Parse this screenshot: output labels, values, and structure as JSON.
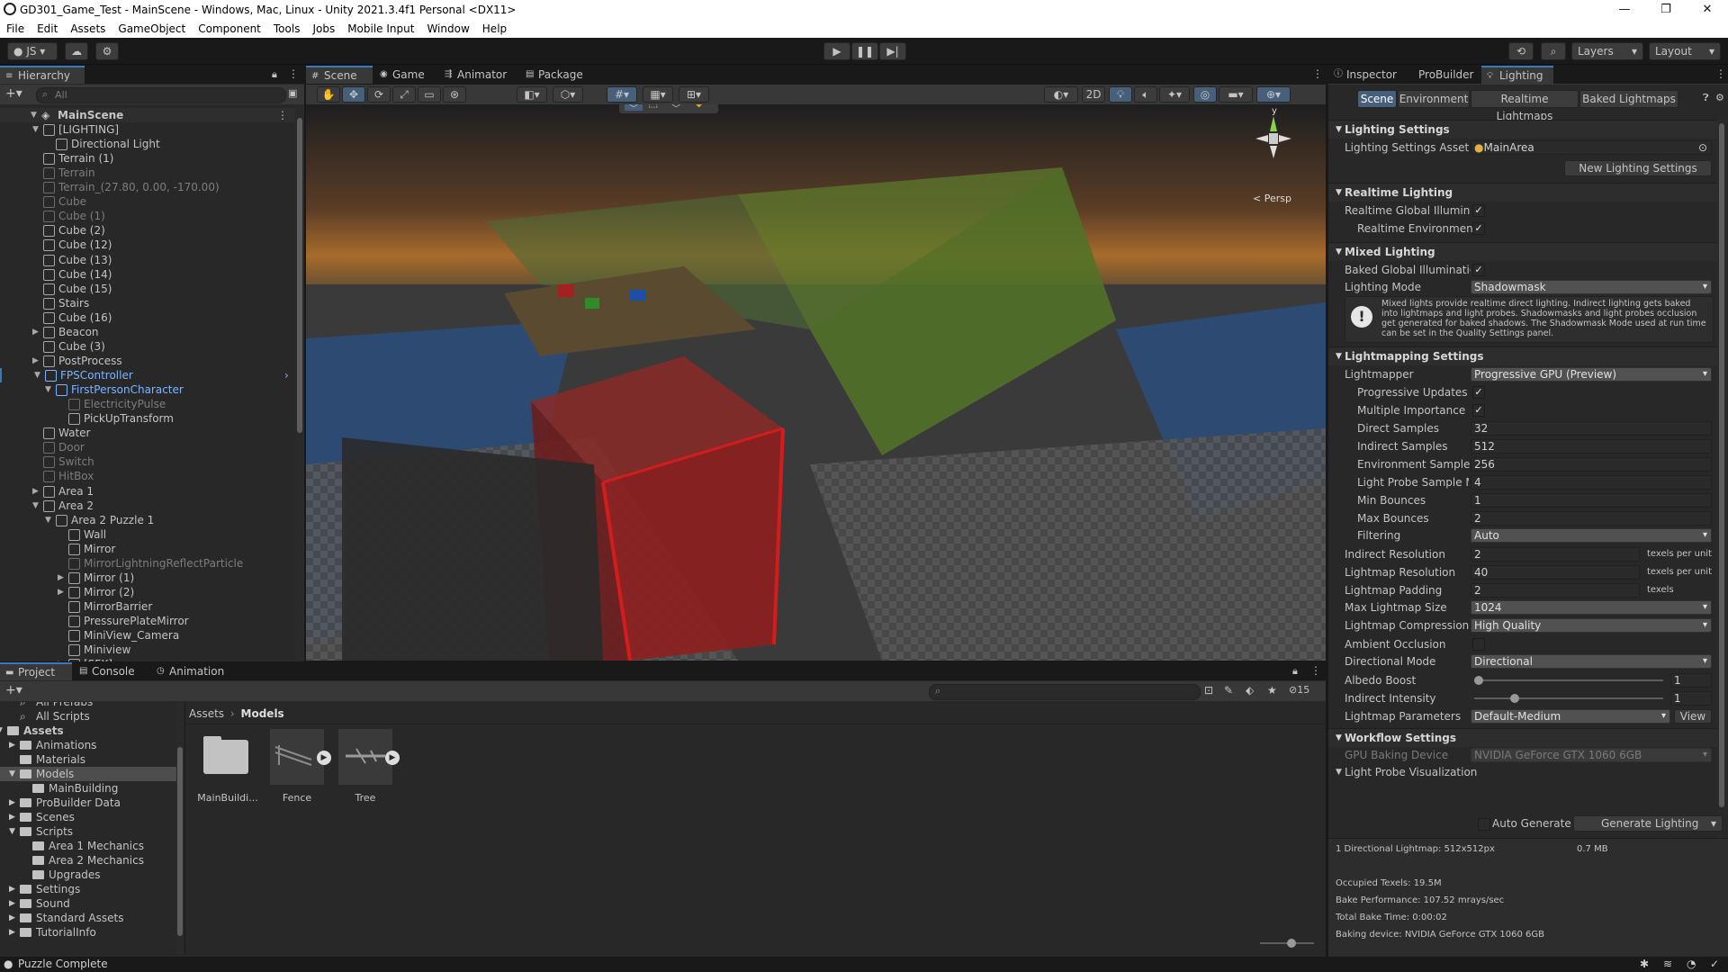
{
  "window": {
    "title": "GD301_Game_Test - MainScene - Windows, Mac, Linux - Unity 2021.3.4f1 Personal <DX11>",
    "minimize_icon": "minimize-icon",
    "restore_icon": "restore-icon",
    "close_icon": "close-icon"
  },
  "menu": [
    "File",
    "Edit",
    "Assets",
    "GameObject",
    "Component",
    "Tools",
    "Jobs",
    "Mobile Input",
    "Window",
    "Help"
  ],
  "toolbar": {
    "account": "JS",
    "layers": "Layers",
    "layout": "Layout"
  },
  "hierarchy": {
    "tab": "Hierarchy",
    "search_placeholder": "All",
    "scene": "MainScene",
    "items": [
      {
        "label": "[LIGHTING]",
        "state": "normal"
      },
      {
        "label": "Directional Light",
        "state": "normal"
      },
      {
        "label": "Terrain (1)",
        "state": "normal"
      },
      {
        "label": "Terrain",
        "state": "dim"
      },
      {
        "label": "Terrain_(27.80, 0.00, -170.00)",
        "state": "dim"
      },
      {
        "label": "Cube",
        "state": "dim"
      },
      {
        "label": "Cube (1)",
        "state": "dim"
      },
      {
        "label": "Cube (2)",
        "state": "normal"
      },
      {
        "label": "Cube (12)",
        "state": "normal"
      },
      {
        "label": "Cube (13)",
        "state": "normal"
      },
      {
        "label": "Cube (14)",
        "state": "normal"
      },
      {
        "label": "Cube (15)",
        "state": "normal"
      },
      {
        "label": "Stairs",
        "state": "normal"
      },
      {
        "label": "Cube (16)",
        "state": "normal"
      },
      {
        "label": "Beacon",
        "state": "normal"
      },
      {
        "label": "Cube (3)",
        "state": "normal"
      },
      {
        "label": "PostProcess",
        "state": "normal"
      },
      {
        "label": "FPSController",
        "state": "blue"
      },
      {
        "label": "FirstPersonCharacter",
        "state": "blue"
      },
      {
        "label": "ElectricityPulse",
        "state": "dim"
      },
      {
        "label": "PickUpTransform",
        "state": "normal"
      },
      {
        "label": "Water",
        "state": "normal"
      },
      {
        "label": "Door",
        "state": "dim"
      },
      {
        "label": "Switch",
        "state": "dim"
      },
      {
        "label": "HitBox",
        "state": "dim"
      },
      {
        "label": "Area 1",
        "state": "normal"
      },
      {
        "label": "Area 2",
        "state": "normal"
      },
      {
        "label": "Area 2 Puzzle 1",
        "state": "normal"
      },
      {
        "label": "Wall",
        "state": "normal"
      },
      {
        "label": "Mirror",
        "state": "normal"
      },
      {
        "label": "MirrorLightningReflectParticle",
        "state": "dim"
      },
      {
        "label": "Mirror (1)",
        "state": "normal"
      },
      {
        "label": "Mirror (2)",
        "state": "normal"
      },
      {
        "label": "MirrorBarrier",
        "state": "normal"
      },
      {
        "label": "PressurePlateMirror",
        "state": "normal"
      },
      {
        "label": "MiniView_Camera",
        "state": "normal"
      },
      {
        "label": "Miniview",
        "state": "normal"
      },
      {
        "label": "[SFX]",
        "state": "normal"
      }
    ]
  },
  "scene_tabs": [
    "Scene",
    "Game",
    "Animator",
    "Package Manager"
  ],
  "scene": {
    "btn_2d": "2D",
    "persp": "< Persp",
    "gizmo_y": "y"
  },
  "inspector": {
    "tabs": [
      "Inspector",
      "ProBuilder",
      "Lighting"
    ],
    "subtabs": [
      "Scene",
      "Environment",
      "Realtime Lightmaps",
      "Baked Lightmaps"
    ],
    "sections": {
      "lighting_settings": "Lighting Settings",
      "realtime_lighting": "Realtime Lighting",
      "mixed_lighting": "Mixed Lighting",
      "lightmapping_settings": "Lightmapping Settings",
      "workflow_settings": "Workflow Settings"
    },
    "lighting_settings_asset_label": "Lighting Settings Asset",
    "lighting_settings_asset_value": "MainArea",
    "new_lighting_settings": "New Lighting Settings",
    "realtime_gi_label": "Realtime Global Illuminat",
    "realtime_env_label": "Realtime Environment",
    "baked_gi_label": "Baked Global Illuminatio",
    "lighting_mode_label": "Lighting Mode",
    "lighting_mode_value": "Shadowmask",
    "mixed_info": "Mixed lights provide realtime direct lighting. Indirect lighting gets baked into lightmaps and light probes. Shadowmasks and light probes occlusion get generated for baked shadows. The Shadowmask Mode used at run time can be set in the Quality Settings panel.",
    "lightmapper_label": "Lightmapper",
    "lightmapper_value": "Progressive GPU (Preview)",
    "progressive_updates_label": "Progressive Updates",
    "multiple_importance_label": "Multiple Importance S",
    "direct_samples_label": "Direct Samples",
    "direct_samples_value": "32",
    "indirect_samples_label": "Indirect Samples",
    "indirect_samples_value": "512",
    "environment_samples_label": "Environment Samples",
    "environment_samples_value": "256",
    "light_probe_sample_label": "Light Probe Sample M",
    "light_probe_sample_value": "4",
    "min_bounces_label": "Min Bounces",
    "min_bounces_value": "1",
    "max_bounces_label": "Max Bounces",
    "max_bounces_value": "2",
    "filtering_label": "Filtering",
    "filtering_value": "Auto",
    "indirect_resolution_label": "Indirect Resolution",
    "indirect_resolution_value": "2",
    "texels_per_unit": "texels per unit",
    "lightmap_resolution_label": "Lightmap Resolution",
    "lightmap_resolution_value": "40",
    "lightmap_padding_label": "Lightmap Padding",
    "lightmap_padding_value": "2",
    "texels": "texels",
    "max_lightmap_size_label": "Max Lightmap Size",
    "max_lightmap_size_value": "1024",
    "lightmap_compression_label": "Lightmap Compression",
    "lightmap_compression_value": "High Quality",
    "ambient_occlusion_label": "Ambient Occlusion",
    "directional_mode_label": "Directional Mode",
    "directional_mode_value": "Directional",
    "albedo_boost_label": "Albedo Boost",
    "albedo_boost_value": "1",
    "albedo_boost_fraction": 0.0,
    "indirect_intensity_label": "Indirect Intensity",
    "indirect_intensity_value": "1",
    "indirect_intensity_fraction": 0.2,
    "lightmap_parameters_label": "Lightmap Parameters",
    "lightmap_parameters_value": "Default-Medium",
    "view_button": "View",
    "gpu_baking_label": "GPU Baking Device",
    "gpu_baking_value": "NVIDIA GeForce GTX 1060 6GB",
    "light_probe_vis": "Light Probe Visualization",
    "auto_generate": "Auto Generate",
    "generate_lighting": "Generate Lighting",
    "stats": {
      "lightmap_info": "1 Directional Lightmap: 512x512px",
      "lightmap_size": "0.7 MB",
      "occupied_texels": "Occupied Texels: 19.5M",
      "bake_performance": "Bake Performance: 107.52 mrays/sec",
      "total_bake_time": "Total Bake Time: 0:00:02",
      "baking_device": "Baking device: NVIDIA GeForce GTX 1060 6GB"
    }
  },
  "project": {
    "tabs": [
      "Project",
      "Console",
      "Animation"
    ],
    "hidden_count": "15",
    "tree": [
      {
        "label": "All Prefabs",
        "indent": 1,
        "type": "search"
      },
      {
        "label": "All Scripts",
        "indent": 1,
        "type": "search"
      },
      {
        "label": "Assets",
        "indent": 0,
        "type": "root"
      },
      {
        "label": "Animations",
        "indent": 1,
        "type": "folder"
      },
      {
        "label": "Materials",
        "indent": 1,
        "type": "folder"
      },
      {
        "label": "Models",
        "indent": 1,
        "type": "folder-selected"
      },
      {
        "label": "MainBuilding",
        "indent": 2,
        "type": "folder"
      },
      {
        "label": "ProBuilder Data",
        "indent": 1,
        "type": "folder"
      },
      {
        "label": "Scenes",
        "indent": 1,
        "type": "folder"
      },
      {
        "label": "Scripts",
        "indent": 1,
        "type": "folder"
      },
      {
        "label": "Area 1 Mechanics",
        "indent": 2,
        "type": "folder"
      },
      {
        "label": "Area 2 Mechanics",
        "indent": 2,
        "type": "folder"
      },
      {
        "label": "Upgrades",
        "indent": 2,
        "type": "folder"
      },
      {
        "label": "Settings",
        "indent": 1,
        "type": "folder"
      },
      {
        "label": "Sound",
        "indent": 1,
        "type": "folder"
      },
      {
        "label": "Standard Assets",
        "indent": 1,
        "type": "folder"
      },
      {
        "label": "TutorialInfo",
        "indent": 1,
        "type": "folder"
      }
    ],
    "breadcrumb": [
      "Assets",
      "Models"
    ],
    "assets": [
      {
        "label": "MainBuildi...",
        "kind": "folder"
      },
      {
        "label": "Fence",
        "kind": "model"
      },
      {
        "label": "Tree",
        "kind": "model"
      }
    ]
  },
  "status": {
    "message": "Puzzle Complete"
  },
  "colors": {
    "accent": "#3a79bb",
    "selection": "#2c5d87",
    "editor_bg": "#282828"
  }
}
